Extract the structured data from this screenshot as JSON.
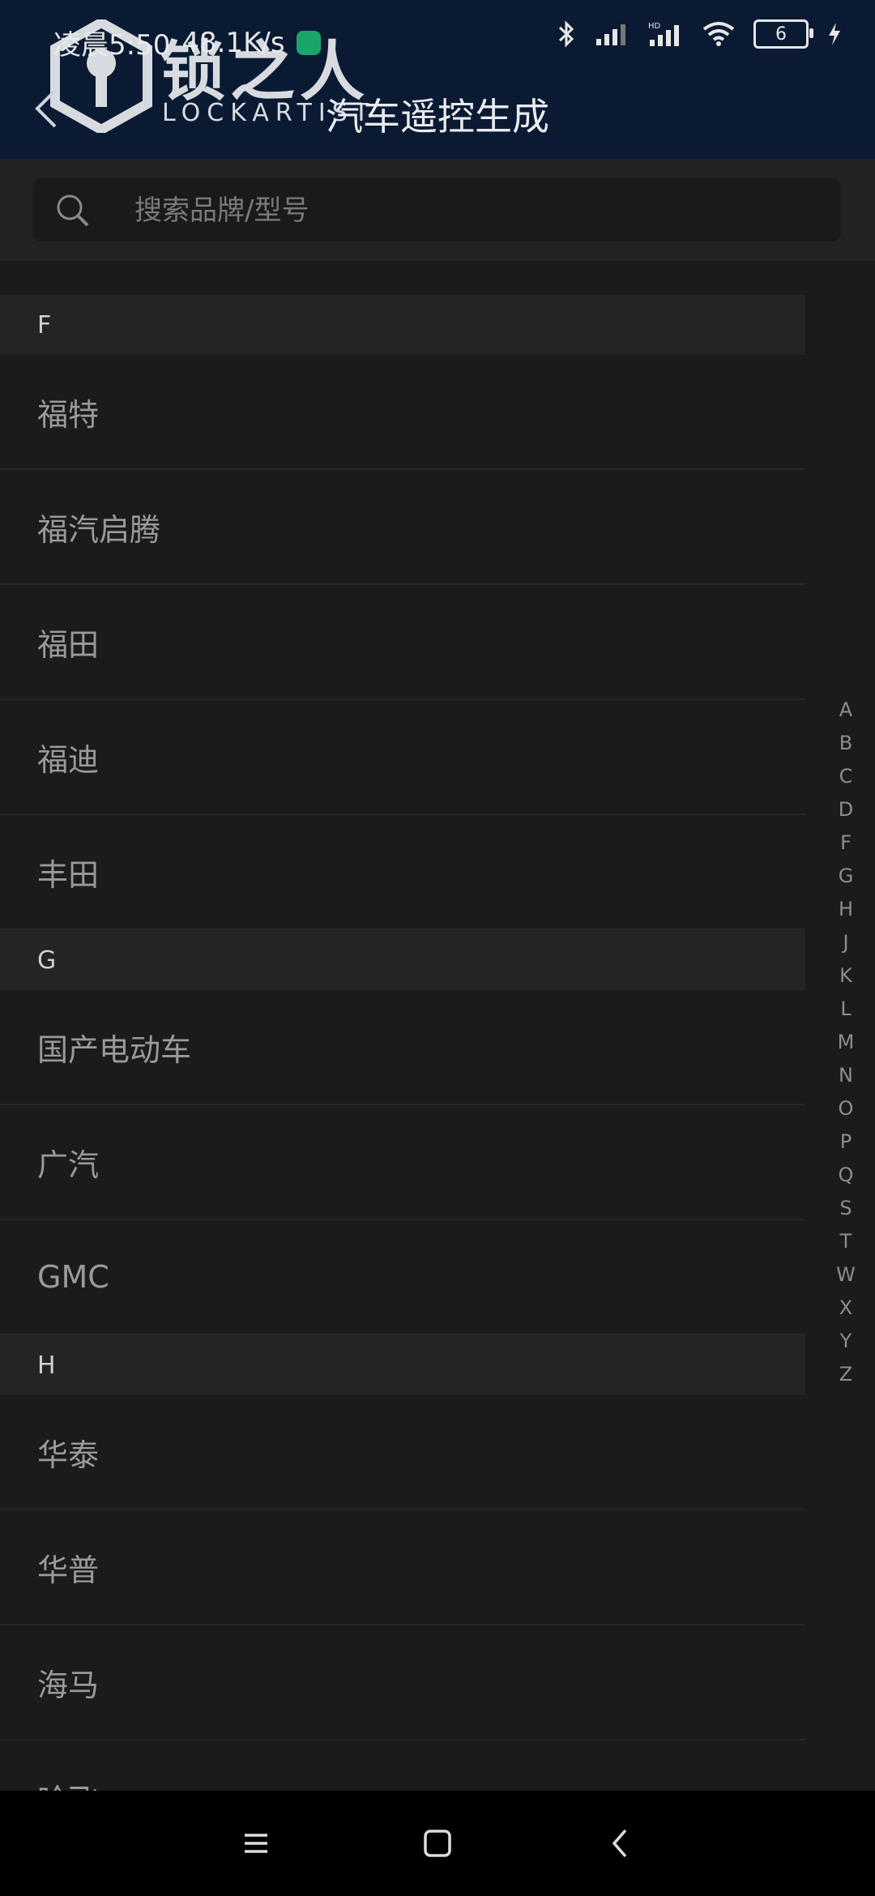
{
  "statusbar": {
    "time": "凌晨5:50",
    "speed": "48.1K/s"
  },
  "header": {
    "title": "汽车遥控生成",
    "logo_cn": "锁之人",
    "logo_en": "LOCKARTIST"
  },
  "search": {
    "placeholder": "搜索品牌/型号"
  },
  "sections": [
    {
      "letter": "F",
      "items": [
        "福特",
        "福汽启腾",
        "福田",
        "福迪",
        "丰田"
      ]
    },
    {
      "letter": "G",
      "items": [
        "国产电动车",
        "广汽",
        "GMC"
      ]
    },
    {
      "letter": "H",
      "items": [
        "华泰",
        "华普",
        "海马",
        "哈飞"
      ]
    }
  ],
  "index_letters": [
    "A",
    "B",
    "C",
    "D",
    "F",
    "G",
    "H",
    "J",
    "K",
    "L",
    "M",
    "N",
    "O",
    "P",
    "Q",
    "S",
    "T",
    "W",
    "X",
    "Y",
    "Z"
  ],
  "battery_level": "6"
}
